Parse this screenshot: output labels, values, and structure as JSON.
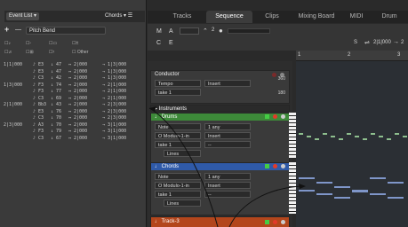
{
  "left_panel": {
    "tab_event_list": "Event List",
    "tab_chords": "Chords",
    "add_symbol": "+",
    "remove_symbol": "—",
    "pitch_bend": "Pitch Bend",
    "filter_other": "Other",
    "events": [
      {
        "time": "1|1|000",
        "note": "E3",
        "vel": "47",
        "dur": "2|000",
        "end": "1|3|000"
      },
      {
        "time": "",
        "note": "E3",
        "vel": "47",
        "dur": "2|000",
        "end": "1|3|000"
      },
      {
        "time": "",
        "note": "C3",
        "vel": "42",
        "dur": "2|000",
        "end": "1|3|000"
      },
      {
        "time": "1|3|000",
        "note": "F3",
        "vel": "74",
        "dur": "2|000",
        "end": "2|1|000"
      },
      {
        "time": "",
        "note": "F3",
        "vel": "77",
        "dur": "2|000",
        "end": "2|1|000"
      },
      {
        "time": "",
        "note": "C3",
        "vel": "69",
        "dur": "2|000",
        "end": "2|1|000"
      },
      {
        "time": "2|1|000",
        "note": "Bb3",
        "vel": "43",
        "dur": "2|000",
        "end": "2|3|000"
      },
      {
        "time": "",
        "note": "E3",
        "vel": "76",
        "dur": "2|000",
        "end": "2|3|000"
      },
      {
        "time": "",
        "note": "C3",
        "vel": "70",
        "dur": "2|000",
        "end": "2|3|000"
      },
      {
        "time": "2|3|000",
        "note": "A3",
        "vel": "70",
        "dur": "2|000",
        "end": "3|1|000"
      },
      {
        "time": "",
        "note": "F3",
        "vel": "79",
        "dur": "2|000",
        "end": "3|1|000"
      },
      {
        "time": "",
        "note": "C3",
        "vel": "67",
        "dur": "2|000",
        "end": "3|1|000"
      }
    ]
  },
  "top_tabs": [
    "Tracks",
    "Sequence",
    "Clips",
    "Mixing Board",
    "MIDI",
    "Drum"
  ],
  "transport": {
    "m": "M",
    "a": "A",
    "c": "C",
    "e": "E",
    "s": "S",
    "position": "2|1|000",
    "num": "2",
    "timecode": "2"
  },
  "ruler": [
    "1",
    "2",
    "3"
  ],
  "tracks": {
    "conductor": {
      "name": "Conductor",
      "sel1": "Tempo",
      "sel2": "Insert",
      "sel3": "take 1",
      "v360": "360",
      "v180": "180",
      "v0": "0"
    },
    "instruments": "Instruments",
    "drums": {
      "name": "Drums",
      "sel1": "Note",
      "sel2": "1 any",
      "sel3": "O Modulo-1-in",
      "sel4": "Insert",
      "sel5": "take 1",
      "sel6": "--",
      "sel7": "Lines"
    },
    "chords": {
      "name": "Chords",
      "sel1": "Note",
      "sel2": "1 any",
      "sel3": "O Modulo-1-in",
      "sel4": "Insert",
      "sel5": "take 1",
      "sel6": "--",
      "sel7": "Lines"
    },
    "track3": {
      "name": "Track-3"
    }
  },
  "colors": {
    "drums": "#3d8a39",
    "chords": "#2f5aa8",
    "track3": "#b3461c",
    "accent_red": "#e23a2a"
  }
}
